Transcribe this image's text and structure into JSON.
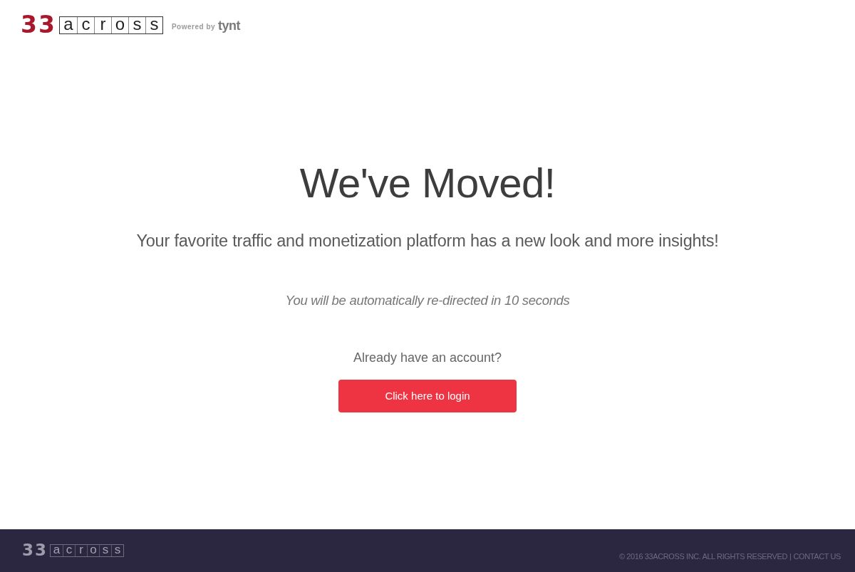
{
  "header": {
    "logo": {
      "number": "33",
      "letters": [
        "a",
        "c",
        "r",
        "o",
        "s",
        "s"
      ]
    },
    "powered_by": {
      "label": "Powered by",
      "brand": "tynt"
    }
  },
  "main": {
    "title": "We've Moved!",
    "subtitle": "Your favorite traffic and monetization platform has a new look and more insights!",
    "redirect_notice": "You will be automatically re-directed in 10 seconds",
    "account_prompt": "Already have an account?",
    "login_button": "Click here to login"
  },
  "footer": {
    "logo": {
      "number": "33",
      "letters": [
        "a",
        "c",
        "r",
        "o",
        "s",
        "s"
      ]
    },
    "copyright": "© 2016 33ACROSS INC. ALL RIGHTS RESERVED",
    "separator": "|",
    "contact_link": "CONTACT US"
  }
}
